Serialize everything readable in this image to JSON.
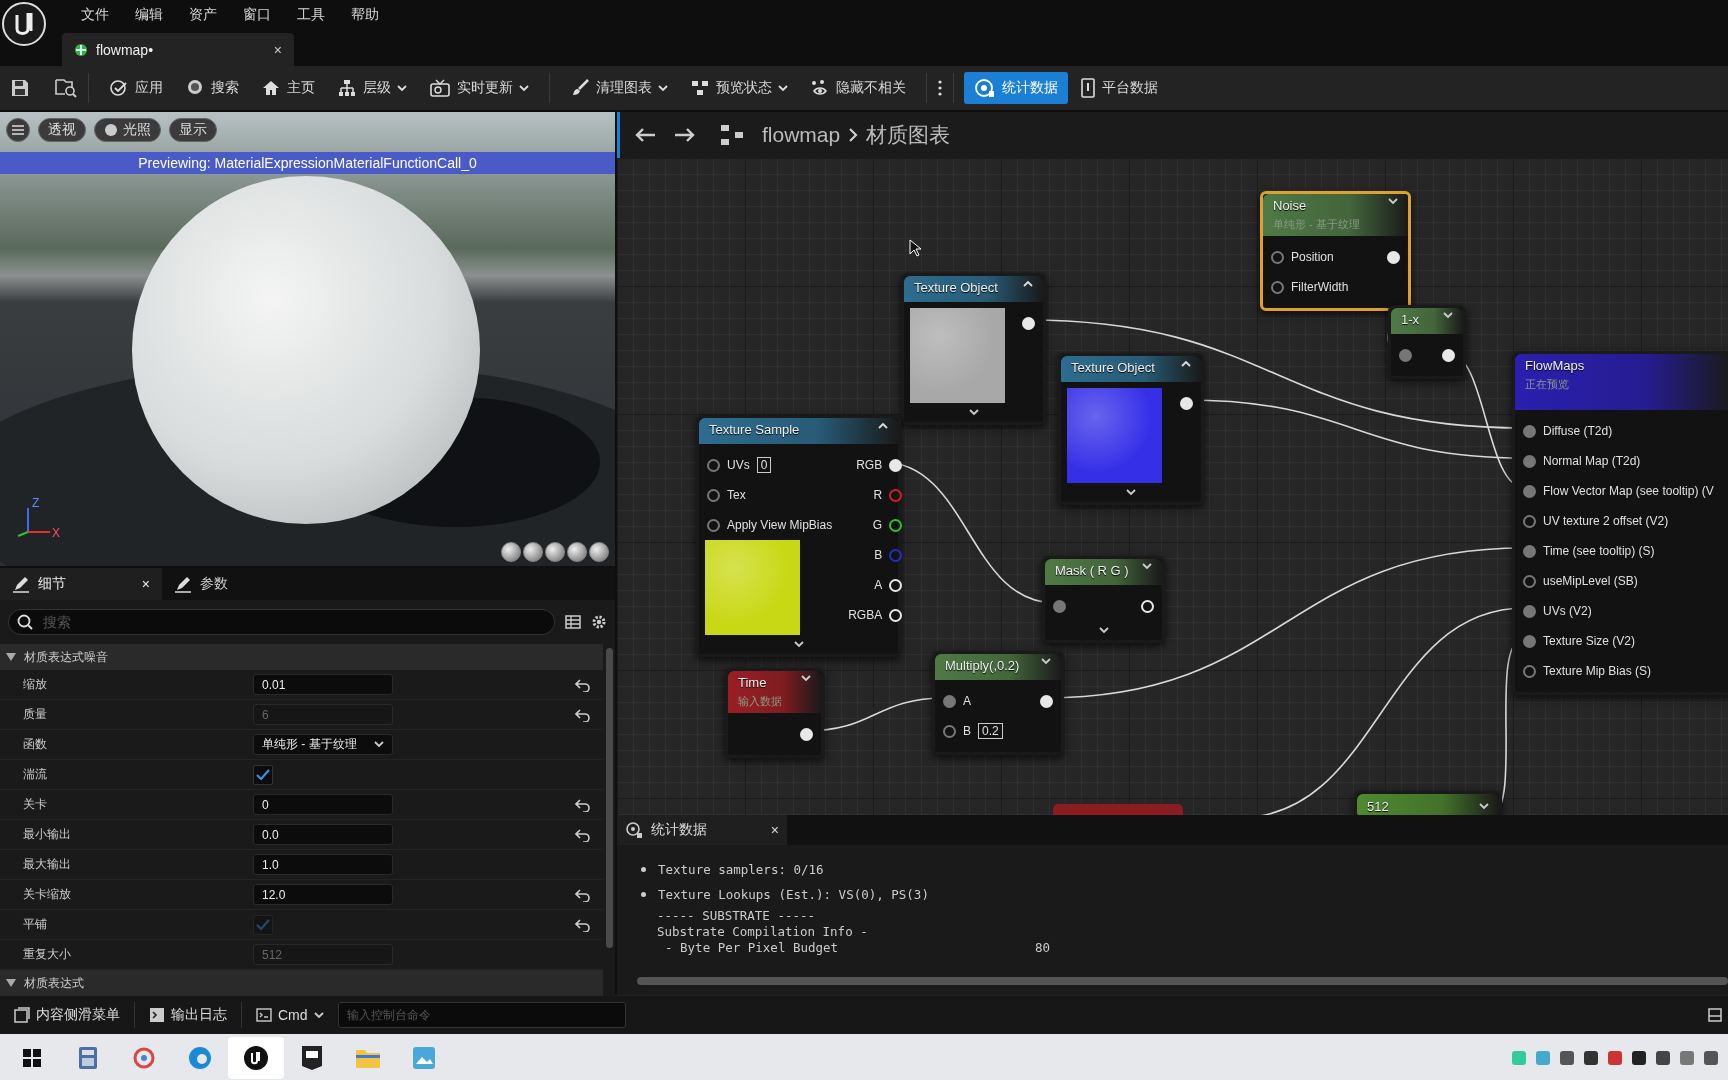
{
  "menu": [
    "文件",
    "编辑",
    "资产",
    "窗口",
    "工具",
    "帮助"
  ],
  "document_tab": {
    "label": "flowmap•",
    "close": "×"
  },
  "toolbar": [
    {
      "label": "应用",
      "dropdown": false,
      "selected": false
    },
    {
      "label": "搜索",
      "dropdown": false,
      "selected": false
    },
    {
      "label": "主页",
      "dropdown": false,
      "selected": false
    },
    {
      "label": "层级",
      "dropdown": true,
      "selected": false
    },
    {
      "label": "实时更新",
      "dropdown": true,
      "selected": false
    },
    {
      "label": "清理图表",
      "dropdown": true,
      "selected": false
    },
    {
      "label": "预览状态",
      "dropdown": true,
      "selected": false
    },
    {
      "label": "隐藏不相关",
      "dropdown": false,
      "selected": false
    },
    {
      "label": "统计数据",
      "dropdown": false,
      "selected": true
    },
    {
      "label": "平台数据",
      "dropdown": false,
      "selected": false
    }
  ],
  "viewport": {
    "buttons": [
      "透视",
      "光照",
      "显示"
    ],
    "preview_banner": "Previewing: MaterialExpressionMaterialFunctionCall_0",
    "axes": [
      "Z",
      "X"
    ]
  },
  "details": {
    "tabs": [
      {
        "label": "细节",
        "selected": true,
        "close": "×"
      },
      {
        "label": "参数",
        "selected": false
      }
    ],
    "search": {
      "placeholder": "搜索"
    },
    "sections": [
      {
        "title": "材质表达式噪音",
        "expanded": true,
        "properties": [
          {
            "kind": "field",
            "label": "缩放",
            "value": "0.01",
            "disabled": false,
            "resettable": true
          },
          {
            "kind": "field",
            "label": "质量",
            "value": "6",
            "disabled": true,
            "resettable": true
          },
          {
            "kind": "dropdown",
            "label": "函数",
            "value": "单纯形 - 基于纹理",
            "disabled": false,
            "resettable": false
          },
          {
            "kind": "checkbox",
            "label": "湍流",
            "checked": true,
            "disabled": false,
            "resettable": false
          },
          {
            "kind": "field",
            "label": "关卡",
            "value": "0",
            "disabled": false,
            "resettable": true
          },
          {
            "kind": "field",
            "label": "最小输出",
            "value": "0.0",
            "disabled": false,
            "resettable": true
          },
          {
            "kind": "field",
            "label": "最大输出",
            "value": "1.0",
            "disabled": false,
            "resettable": false
          },
          {
            "kind": "field",
            "label": "关卡缩放",
            "value": "12.0",
            "disabled": false,
            "resettable": true
          },
          {
            "kind": "checkbox",
            "label": "平铺",
            "checked": true,
            "disabled": true,
            "resettable": true
          },
          {
            "kind": "field",
            "label": "重复大小",
            "value": "512",
            "disabled": true,
            "resettable": false
          }
        ]
      },
      {
        "title": "材质表达式",
        "expanded": true
      }
    ]
  },
  "graph": {
    "breadcrumb": [
      "flowmap",
      "材质图表"
    ],
    "nodes": [
      {
        "kind": "texture_object",
        "title": "Texture Object",
        "color": "#2d6d8f",
        "selected": false,
        "advanced_pins": true,
        "outputs": [
          {
            "connected": true
          }
        ]
      },
      {
        "kind": "texture_object",
        "title": "Texture Object",
        "color": "#2d6d8f",
        "selected": false,
        "advanced_pins": true,
        "outputs": [
          {
            "connected": true
          }
        ]
      },
      {
        "kind": "noise",
        "title": "Noise",
        "subtitle": "单纯形 - 基于纹理",
        "color": "#4f7a45",
        "selected": true,
        "inputs": [
          {
            "label": "Position",
            "connected": false
          },
          {
            "label": "FilterWidth",
            "connected": false
          }
        ],
        "outputs": [
          {
            "connected": true
          }
        ]
      },
      {
        "kind": "math",
        "title": "1-x",
        "color": "#4f7a45",
        "selected": false,
        "inputs": [
          {
            "connected": true
          }
        ],
        "outputs": [
          {
            "connected": true
          }
        ]
      },
      {
        "kind": "texture_sample",
        "title": "Texture Sample",
        "color": "#2d6d8f",
        "selected": false,
        "advanced_pins": true,
        "inputs": [
          {
            "label": "UVs",
            "value": "0",
            "connected": false
          },
          {
            "label": "Tex",
            "connected": false
          },
          {
            "label": "Apply View MipBias",
            "connected": false
          }
        ],
        "outputs": [
          {
            "label": "RGB",
            "connected": true
          },
          {
            "label": "R",
            "connected": false,
            "color": "#d02020"
          },
          {
            "label": "G",
            "connected": false,
            "color": "#30c030"
          },
          {
            "label": "B",
            "connected": false,
            "color": "#2030c0"
          },
          {
            "label": "A",
            "connected": false
          },
          {
            "label": "RGBA",
            "connected": false
          }
        ]
      },
      {
        "kind": "math",
        "title": "Mask ( R G )",
        "color": "#4f7a45",
        "selected": false,
        "advanced_pins": true,
        "inputs": [
          {
            "connected": true
          }
        ],
        "outputs": [
          {
            "connected": false
          }
        ]
      },
      {
        "kind": "input",
        "title": "Time",
        "subtitle": "输入数据",
        "color": "#9a1f24",
        "selected": false,
        "outputs": [
          {
            "connected": true
          }
        ]
      },
      {
        "kind": "math",
        "title": "Multiply(,0.2)",
        "color": "#4f7a45",
        "selected": false,
        "inputs": [
          {
            "label": "A",
            "connected": true
          },
          {
            "label": "B",
            "value": "0.2",
            "connected": false
          }
        ],
        "outputs": [
          {
            "connected": true
          }
        ]
      },
      {
        "kind": "partial",
        "color": "#8a1c22"
      },
      {
        "kind": "constant",
        "title": "512",
        "color": "#4f8a30",
        "selected": false
      },
      {
        "kind": "function_call",
        "title": "FlowMaps",
        "subtitle": "正在预览",
        "color": "#2a1fb0",
        "selected": false,
        "inputs": [
          {
            "label": "Diffuse (T2d)",
            "connected": true
          },
          {
            "label": "Normal Map (T2d)",
            "connected": true
          },
          {
            "label": "Flow Vector Map (see tooltip) (V",
            "connected": true
          },
          {
            "label": "UV texture 2 offset (V2)",
            "connected": false
          },
          {
            "label": "Time (see tooltip) (S)",
            "connected": true
          },
          {
            "label": "useMipLevel (SB)",
            "connected": false
          },
          {
            "label": "UVs (V2)",
            "connected": true
          },
          {
            "label": "Texture Size (V2)",
            "connected": true
          },
          {
            "label": "Texture Mip Bias (S)",
            "connected": false
          }
        ]
      }
    ]
  },
  "stats": {
    "tab": {
      "label": "统计数据",
      "close": "×"
    },
    "lines": [
      {
        "kind": "bullet",
        "text": "Texture samplers: 0/16"
      },
      {
        "kind": "bullet",
        "text": "Texture Lookups (Est.): VS(0), PS(3)"
      },
      {
        "kind": "plain",
        "text": "----- SUBSTRATE -----"
      },
      {
        "kind": "plain",
        "text": "Substrate Compilation Info -"
      },
      {
        "kind": "entry",
        "text": "- Byte Per Pixel Budget",
        "value": "80"
      }
    ]
  },
  "bottom_bar": {
    "items": [
      "内容侧滑菜单",
      "输出日志"
    ],
    "cmd": "Cmd",
    "console": {
      "placeholder": "输入控制台命令"
    }
  },
  "taskbar": {
    "apps": [
      {
        "selected": false
      },
      {
        "selected": false
      },
      {
        "selected": false
      },
      {
        "selected": false
      },
      {
        "selected": true
      },
      {
        "selected": false
      },
      {
        "selected": false
      },
      {
        "selected": false
      }
    ]
  }
}
